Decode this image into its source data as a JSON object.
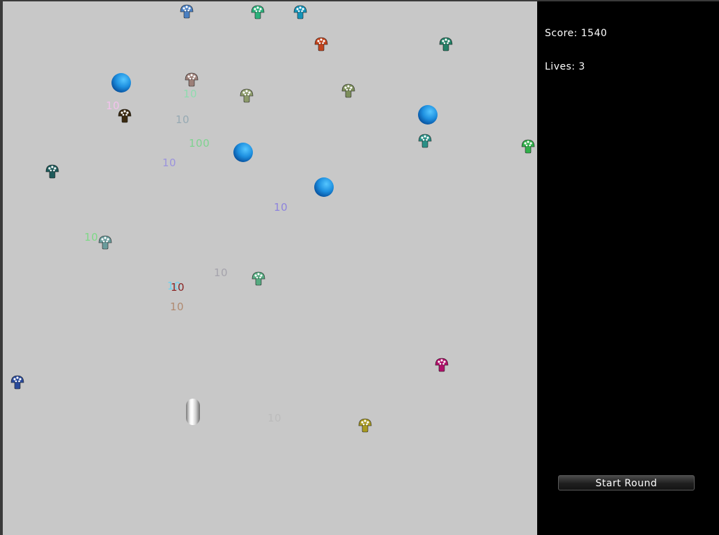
{
  "panel": {
    "score_text": "Score: 1540",
    "lives_text": "Lives: 3",
    "start_button_label": "Start Round"
  },
  "game": {
    "player_icon": "capsule-shooter",
    "ball_color": "#1e90e0",
    "mushrooms": [
      {
        "color": "#4a7fc1"
      },
      {
        "color": "#2bb07a"
      },
      {
        "color": "#1493b8"
      },
      {
        "color": "#c2431c"
      },
      {
        "color": "#238066"
      },
      {
        "color": "#9c7f78"
      },
      {
        "color": "#8c9a6a"
      },
      {
        "color": "#7c8e5a"
      },
      {
        "color": "#3b2a10"
      },
      {
        "color": "#2a8f86"
      },
      {
        "color": "#30b04a"
      },
      {
        "color": "#1e5a5a"
      },
      {
        "color": "#6a9c9c"
      },
      {
        "color": "#55aa80"
      },
      {
        "color": "#b0106a"
      },
      {
        "color": "#2a4a9a"
      },
      {
        "color": "#a89a20"
      }
    ],
    "floating_scores": [
      {
        "text": "10",
        "color": "#8fdcaf"
      },
      {
        "text": "10",
        "color": "#f2c2ec"
      },
      {
        "text": "10",
        "color": "#96a9b3"
      },
      {
        "text": "100",
        "color": "#7fd390"
      },
      {
        "text": "10",
        "color": "#9b93dd"
      },
      {
        "text": "10",
        "color": "#8d83dc"
      },
      {
        "text": "10",
        "color": "#7ed987"
      },
      {
        "text": "10",
        "color": "#a5a3ac"
      },
      {
        "text": "10",
        "color": "#6fd4ef"
      },
      {
        "text": "10",
        "color": "#8a2424"
      },
      {
        "text": "10",
        "color": "#b08a70"
      },
      {
        "text": "10",
        "color": "#bcbcbc"
      }
    ]
  }
}
